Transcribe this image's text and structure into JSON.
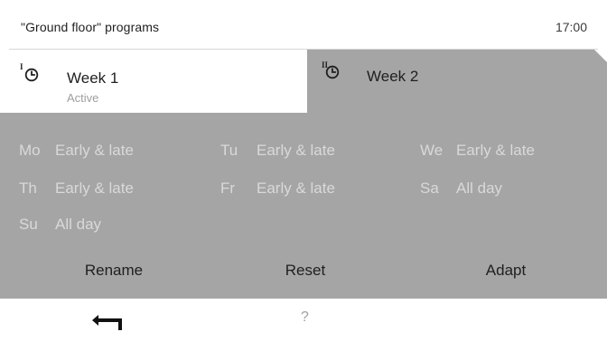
{
  "header": {
    "title": "\"Ground floor\" programs",
    "time": "17:00"
  },
  "tabs": [
    {
      "roman": "I",
      "label": "Week 1",
      "sublabel": "Active",
      "selected": true,
      "icon": "clock-icon"
    },
    {
      "roman": "II",
      "label": "Week 2",
      "selected": false,
      "icon": "clock-icon"
    }
  ],
  "schedule": [
    {
      "day": "Mo",
      "program": "Early & late"
    },
    {
      "day": "Tu",
      "program": "Early & late"
    },
    {
      "day": "We",
      "program": "Early & late"
    },
    {
      "day": "Th",
      "program": "Early & late"
    },
    {
      "day": "Fr",
      "program": "Early & late"
    },
    {
      "day": "Sa",
      "program": "All day"
    },
    {
      "day": "Su",
      "program": "All day"
    }
  ],
  "actions": {
    "rename": "Rename",
    "reset": "Reset",
    "adapt": "Adapt"
  },
  "footer": {
    "back_icon": "back-arrow-icon",
    "help": "?"
  },
  "colors": {
    "panel": "#a5a5a5",
    "panel_text": "#d9d9d9",
    "text": "#1f1f1f",
    "muted": "#9e9e9e"
  }
}
